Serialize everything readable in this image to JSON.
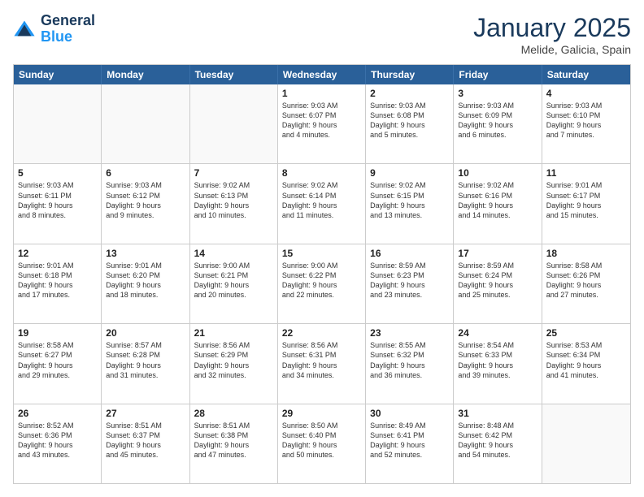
{
  "header": {
    "logo_line1": "General",
    "logo_line2": "Blue",
    "month": "January 2025",
    "location": "Melide, Galicia, Spain"
  },
  "days_of_week": [
    "Sunday",
    "Monday",
    "Tuesday",
    "Wednesday",
    "Thursday",
    "Friday",
    "Saturday"
  ],
  "rows": [
    [
      {
        "day": "",
        "info": ""
      },
      {
        "day": "",
        "info": ""
      },
      {
        "day": "",
        "info": ""
      },
      {
        "day": "1",
        "info": "Sunrise: 9:03 AM\nSunset: 6:07 PM\nDaylight: 9 hours\nand 4 minutes."
      },
      {
        "day": "2",
        "info": "Sunrise: 9:03 AM\nSunset: 6:08 PM\nDaylight: 9 hours\nand 5 minutes."
      },
      {
        "day": "3",
        "info": "Sunrise: 9:03 AM\nSunset: 6:09 PM\nDaylight: 9 hours\nand 6 minutes."
      },
      {
        "day": "4",
        "info": "Sunrise: 9:03 AM\nSunset: 6:10 PM\nDaylight: 9 hours\nand 7 minutes."
      }
    ],
    [
      {
        "day": "5",
        "info": "Sunrise: 9:03 AM\nSunset: 6:11 PM\nDaylight: 9 hours\nand 8 minutes."
      },
      {
        "day": "6",
        "info": "Sunrise: 9:03 AM\nSunset: 6:12 PM\nDaylight: 9 hours\nand 9 minutes."
      },
      {
        "day": "7",
        "info": "Sunrise: 9:02 AM\nSunset: 6:13 PM\nDaylight: 9 hours\nand 10 minutes."
      },
      {
        "day": "8",
        "info": "Sunrise: 9:02 AM\nSunset: 6:14 PM\nDaylight: 9 hours\nand 11 minutes."
      },
      {
        "day": "9",
        "info": "Sunrise: 9:02 AM\nSunset: 6:15 PM\nDaylight: 9 hours\nand 13 minutes."
      },
      {
        "day": "10",
        "info": "Sunrise: 9:02 AM\nSunset: 6:16 PM\nDaylight: 9 hours\nand 14 minutes."
      },
      {
        "day": "11",
        "info": "Sunrise: 9:01 AM\nSunset: 6:17 PM\nDaylight: 9 hours\nand 15 minutes."
      }
    ],
    [
      {
        "day": "12",
        "info": "Sunrise: 9:01 AM\nSunset: 6:18 PM\nDaylight: 9 hours\nand 17 minutes."
      },
      {
        "day": "13",
        "info": "Sunrise: 9:01 AM\nSunset: 6:20 PM\nDaylight: 9 hours\nand 18 minutes."
      },
      {
        "day": "14",
        "info": "Sunrise: 9:00 AM\nSunset: 6:21 PM\nDaylight: 9 hours\nand 20 minutes."
      },
      {
        "day": "15",
        "info": "Sunrise: 9:00 AM\nSunset: 6:22 PM\nDaylight: 9 hours\nand 22 minutes."
      },
      {
        "day": "16",
        "info": "Sunrise: 8:59 AM\nSunset: 6:23 PM\nDaylight: 9 hours\nand 23 minutes."
      },
      {
        "day": "17",
        "info": "Sunrise: 8:59 AM\nSunset: 6:24 PM\nDaylight: 9 hours\nand 25 minutes."
      },
      {
        "day": "18",
        "info": "Sunrise: 8:58 AM\nSunset: 6:26 PM\nDaylight: 9 hours\nand 27 minutes."
      }
    ],
    [
      {
        "day": "19",
        "info": "Sunrise: 8:58 AM\nSunset: 6:27 PM\nDaylight: 9 hours\nand 29 minutes."
      },
      {
        "day": "20",
        "info": "Sunrise: 8:57 AM\nSunset: 6:28 PM\nDaylight: 9 hours\nand 31 minutes."
      },
      {
        "day": "21",
        "info": "Sunrise: 8:56 AM\nSunset: 6:29 PM\nDaylight: 9 hours\nand 32 minutes."
      },
      {
        "day": "22",
        "info": "Sunrise: 8:56 AM\nSunset: 6:31 PM\nDaylight: 9 hours\nand 34 minutes."
      },
      {
        "day": "23",
        "info": "Sunrise: 8:55 AM\nSunset: 6:32 PM\nDaylight: 9 hours\nand 36 minutes."
      },
      {
        "day": "24",
        "info": "Sunrise: 8:54 AM\nSunset: 6:33 PM\nDaylight: 9 hours\nand 39 minutes."
      },
      {
        "day": "25",
        "info": "Sunrise: 8:53 AM\nSunset: 6:34 PM\nDaylight: 9 hours\nand 41 minutes."
      }
    ],
    [
      {
        "day": "26",
        "info": "Sunrise: 8:52 AM\nSunset: 6:36 PM\nDaylight: 9 hours\nand 43 minutes."
      },
      {
        "day": "27",
        "info": "Sunrise: 8:51 AM\nSunset: 6:37 PM\nDaylight: 9 hours\nand 45 minutes."
      },
      {
        "day": "28",
        "info": "Sunrise: 8:51 AM\nSunset: 6:38 PM\nDaylight: 9 hours\nand 47 minutes."
      },
      {
        "day": "29",
        "info": "Sunrise: 8:50 AM\nSunset: 6:40 PM\nDaylight: 9 hours\nand 50 minutes."
      },
      {
        "day": "30",
        "info": "Sunrise: 8:49 AM\nSunset: 6:41 PM\nDaylight: 9 hours\nand 52 minutes."
      },
      {
        "day": "31",
        "info": "Sunrise: 8:48 AM\nSunset: 6:42 PM\nDaylight: 9 hours\nand 54 minutes."
      },
      {
        "day": "",
        "info": ""
      }
    ]
  ]
}
